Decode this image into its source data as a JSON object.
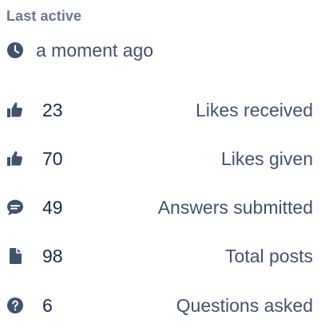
{
  "last_active": {
    "title": "Last active",
    "time": "a moment ago",
    "icon": "clock-icon"
  },
  "stats": [
    {
      "icon": "thumbs-up-icon",
      "value": "23",
      "label": "Likes received"
    },
    {
      "icon": "thumbs-up-icon",
      "value": "70",
      "label": "Likes given"
    },
    {
      "icon": "comment-icon",
      "value": "49",
      "label": "Answers submitted"
    },
    {
      "icon": "document-icon",
      "value": "98",
      "label": "Total posts"
    },
    {
      "icon": "question-icon",
      "value": "6",
      "label": "Questions asked"
    }
  ],
  "colors": {
    "title": "#6B778C",
    "icon": "#42526E",
    "value": "#172B4D",
    "label": "#42526E"
  }
}
